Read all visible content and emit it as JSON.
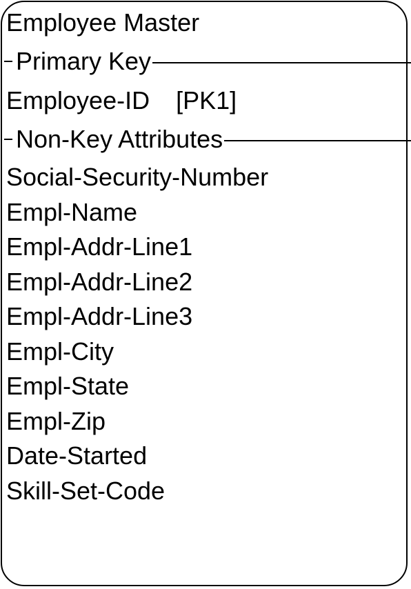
{
  "entity": {
    "name": "Employee Master",
    "primary_key_section": {
      "label": "Primary Key",
      "attributes": [
        {
          "name": "Employee-ID",
          "tag": "[PK1]"
        }
      ]
    },
    "non_key_section": {
      "label": "Non-Key Attributes",
      "attributes": [
        "Social-Security-Number",
        "Empl-Name",
        "Empl-Addr-Line1",
        "Empl-Addr-Line2",
        "Empl-Addr-Line3",
        "Empl-City",
        "Empl-State",
        "Empl-Zip",
        "Date-Started",
        "Skill-Set-Code"
      ]
    }
  },
  "colors": {
    "stroke": "#000000",
    "background": "#ffffff"
  }
}
